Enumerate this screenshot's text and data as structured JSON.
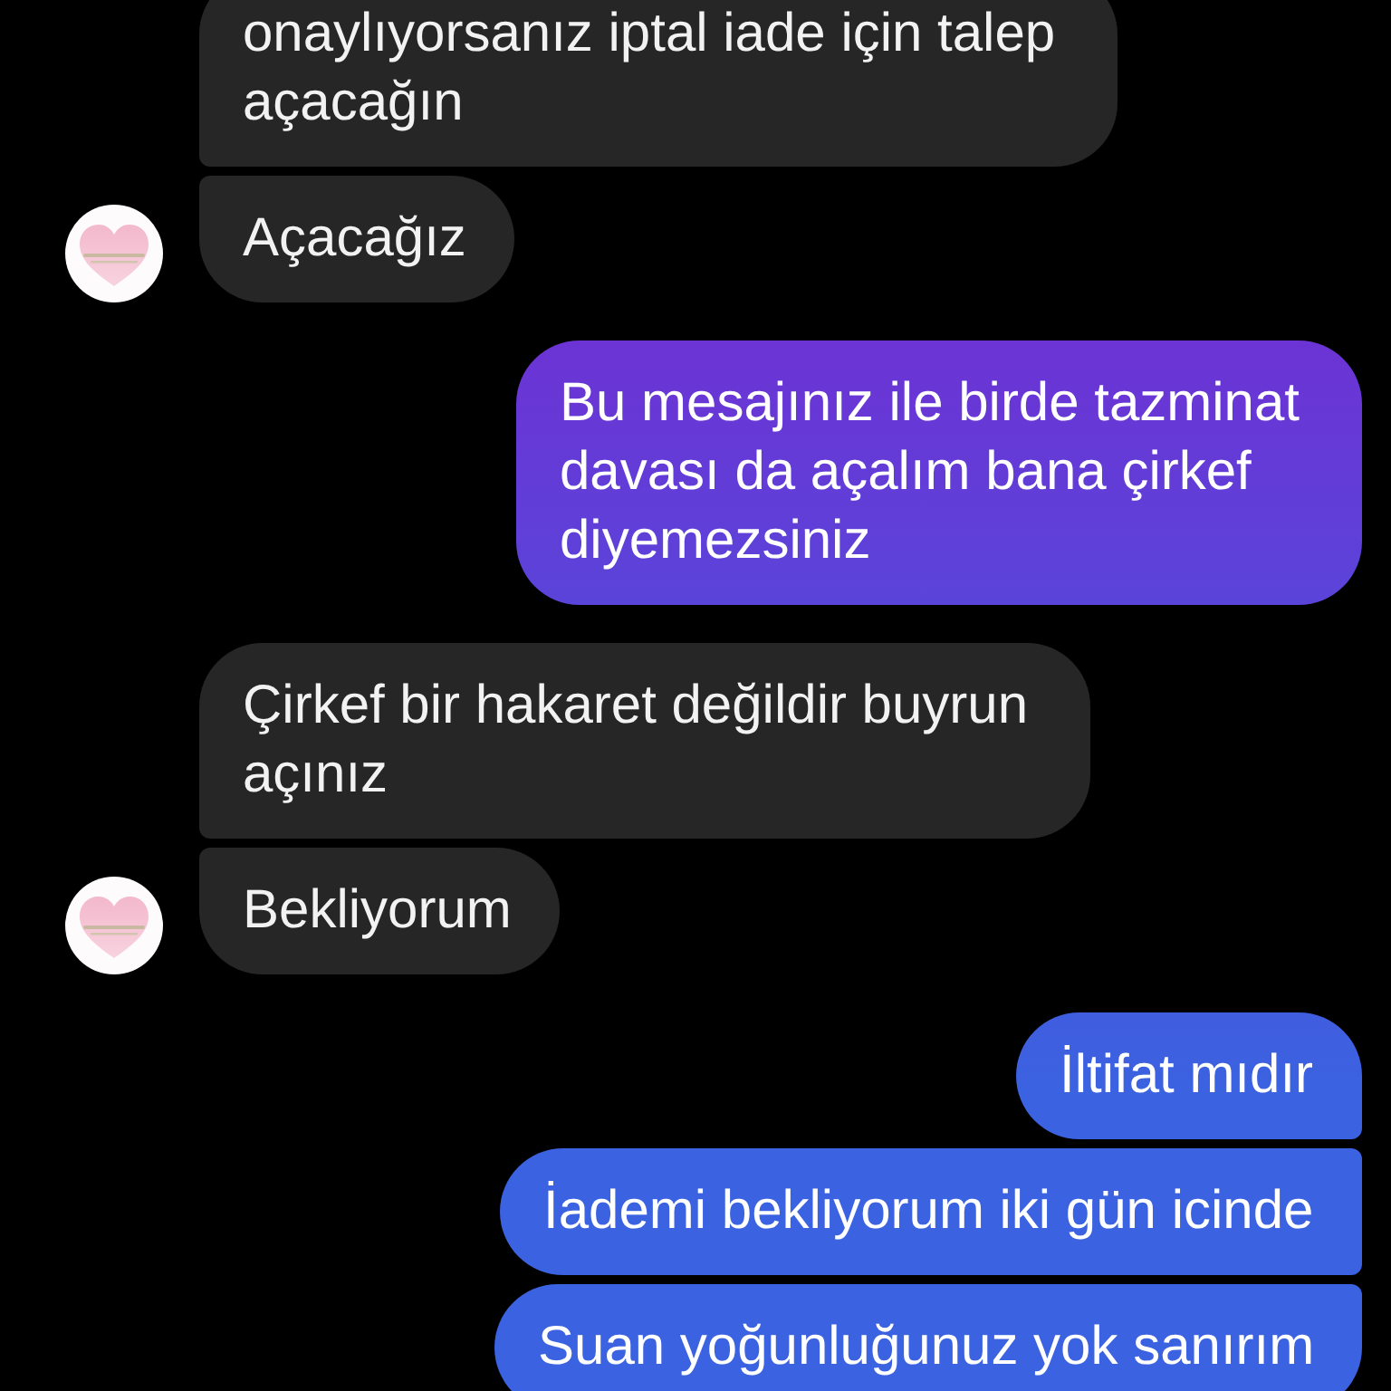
{
  "messages": [
    {
      "kind": "received",
      "avatar": false,
      "text": "onaylıyorsanız iptal iade için talep açacağın"
    },
    {
      "kind": "received",
      "avatar": true,
      "text": "Açacağız"
    },
    {
      "kind": "sent",
      "avatar": false,
      "text": "Bu mesajınız ile birde tazminat davası da açalım bana çirkef diyemezsiniz"
    },
    {
      "kind": "received",
      "avatar": false,
      "text": "Çirkef bir hakaret değildir buyrun açınız"
    },
    {
      "kind": "received",
      "avatar": true,
      "text": "Bekliyorum"
    },
    {
      "kind": "sent",
      "avatar": false,
      "text": "İltifat mıdır"
    },
    {
      "kind": "sent",
      "avatar": false,
      "text": "İademi bekliyorum iki gün icinde"
    },
    {
      "kind": "sent",
      "avatar": false,
      "text": "Suan yoğunluğunuz yok sanırım"
    }
  ]
}
